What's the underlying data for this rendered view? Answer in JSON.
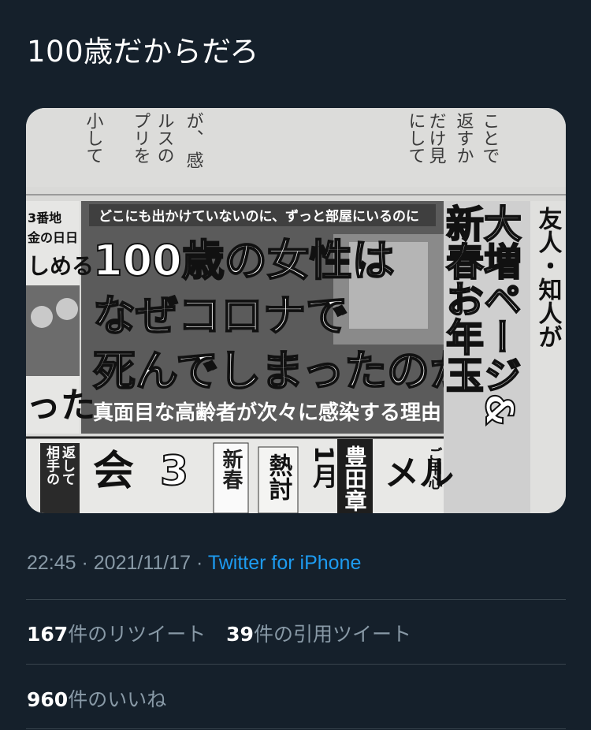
{
  "tweet": {
    "text": "100歳だからだろ",
    "time": "22:45",
    "separator": " · ",
    "date": "2021/11/17",
    "source": "Twitter for iPhone"
  },
  "stats": {
    "retweets_count": "167",
    "retweets_label": "件のリツイート",
    "quotes_count": "39",
    "quotes_label": "件の引用ツイート",
    "likes_count": "960",
    "likes_label": "件のいいね"
  },
  "media": {
    "top_cols": [
      "だけ見",
      "ことで",
      "返すか",
      "にして",
      "ルスの",
      "プリを",
      "小して",
      "が、",
      "感"
    ],
    "lead": "どこにも出かけていないのに、ずっと部屋にいるのに",
    "headline_1": "100歳の女性は",
    "headline_2": "なぜコロナで",
    "headline_3": "死んでしまったのか",
    "subhead": "真面目な高齢者が次々に感染する理由",
    "left_1": "3番地",
    "left_2": "金の日日",
    "left_3": "しめる",
    "left_4": "った",
    "right_big": "大増ページ&",
    "right_big2": "新春お年玉",
    "right_side": "友人・知人が",
    "bottom_1": "会",
    "bottom_2": "3",
    "bottom_3": "新春",
    "bottom_4": "熱討",
    "bottom_5": "1月",
    "bottom_6": "豊田章",
    "bottom_7": "メル",
    "bottom_8": "ご用心",
    "bottom_9": "相手の",
    "bottom_10": "返して"
  },
  "colors": {
    "background": "#15202b",
    "text": "#ffffff",
    "muted": "#8899a6",
    "link": "#1d9bf0",
    "divider": "#38444d"
  }
}
